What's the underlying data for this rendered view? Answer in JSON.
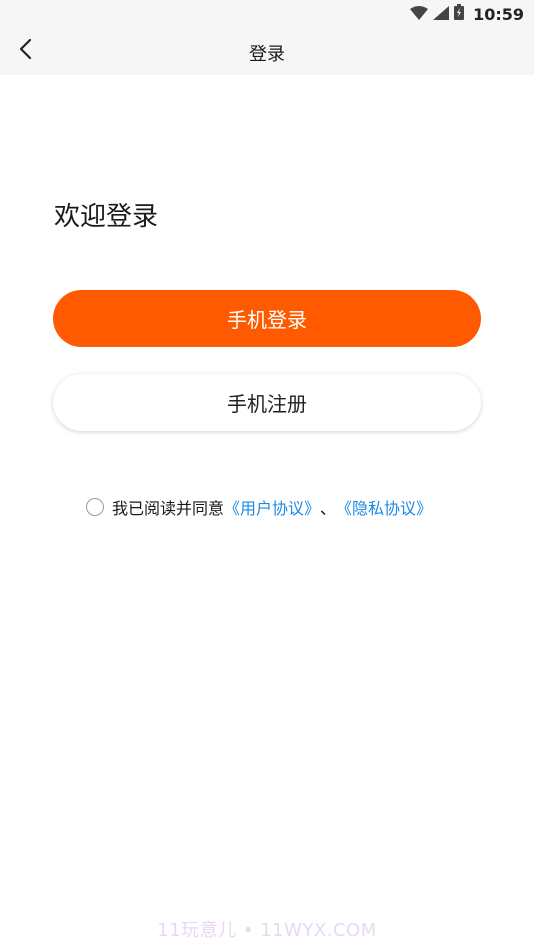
{
  "status_bar": {
    "time": "10:59",
    "icons": [
      "wifi-icon",
      "signal-icon",
      "battery-icon"
    ]
  },
  "nav": {
    "back_icon": "chevron-left-icon",
    "title": "登录"
  },
  "main": {
    "welcome": "欢迎登录",
    "login_button": "手机登录",
    "register_button": "手机注册"
  },
  "agreement": {
    "prefix": "我已阅读并同意",
    "user_agreement": "《用户协议》",
    "separator": "、",
    "privacy_policy": "《隐私协议》",
    "checked": false
  },
  "watermark": "11玩意儿 • 11WYX.COM",
  "colors": {
    "accent": "#ff5a00",
    "link": "#1e88e5",
    "header_bg": "#f6f6f6"
  }
}
